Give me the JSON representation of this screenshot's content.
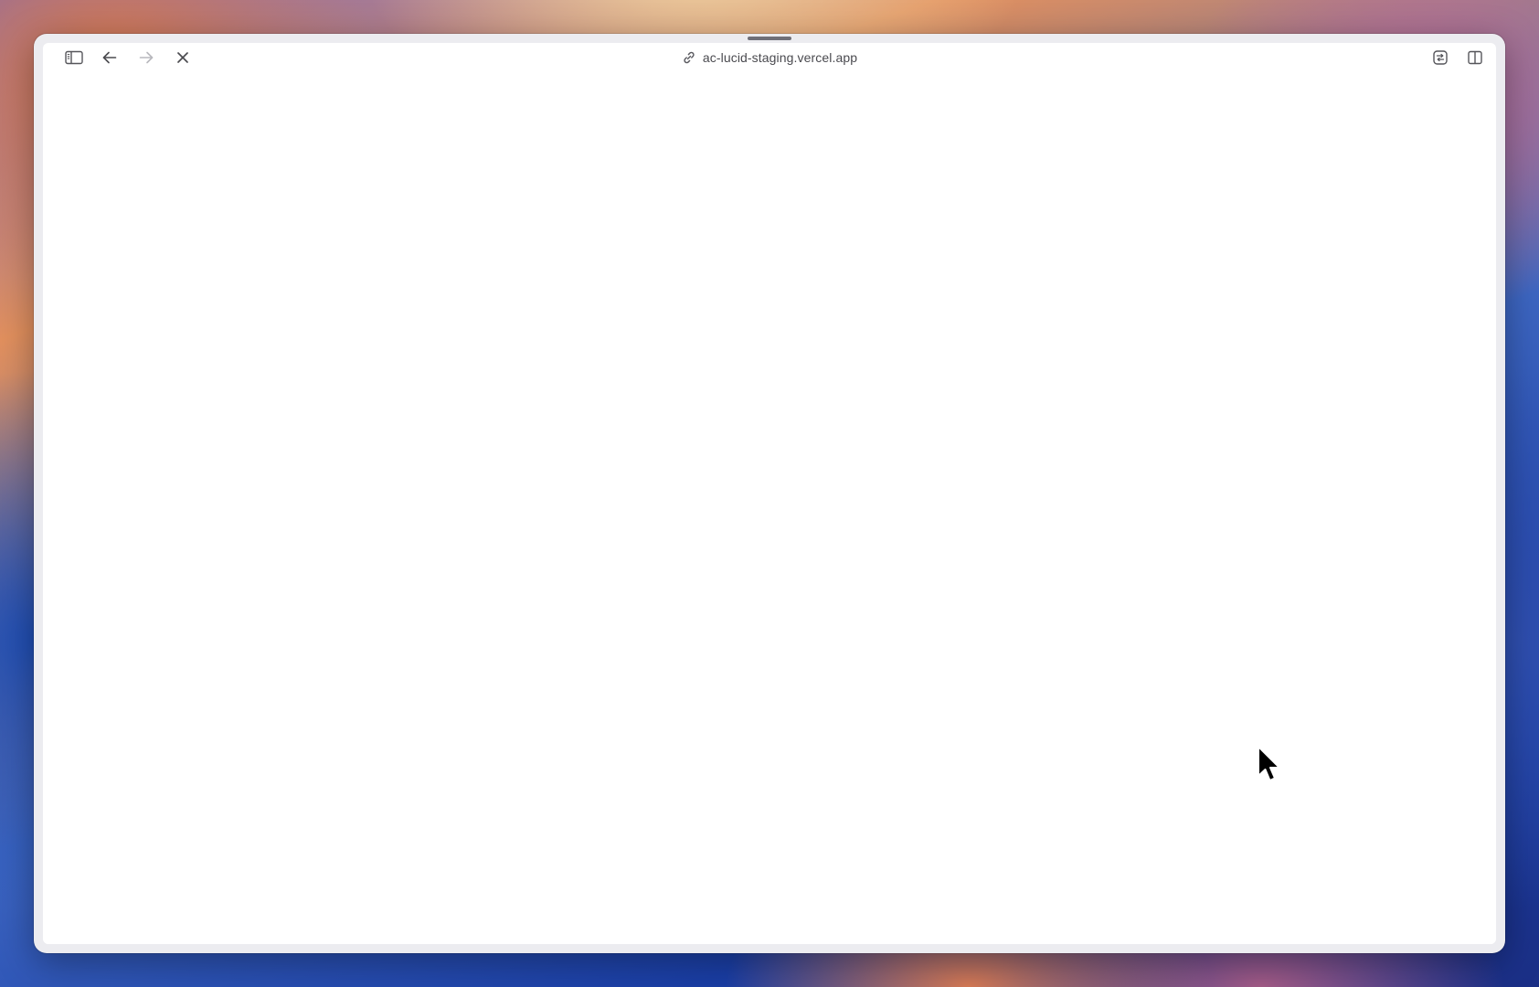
{
  "browser": {
    "url": "ac-lucid-staging.vercel.app",
    "toolbar": {
      "sidebar_icon": "sidebar-icon",
      "back_icon": "arrow-left-icon",
      "forward_icon": "arrow-right-icon",
      "stop_icon": "close-icon",
      "link_icon": "link-icon",
      "reader_icon": "page-menu-icon",
      "split_icon": "split-view-icon"
    }
  },
  "page": {
    "state": "blank"
  },
  "colors": {
    "window_chrome": "#ececf0",
    "content_background": "#ffffff",
    "icon_active": "#4a4a4f",
    "icon_disabled": "#b8b8bd"
  }
}
